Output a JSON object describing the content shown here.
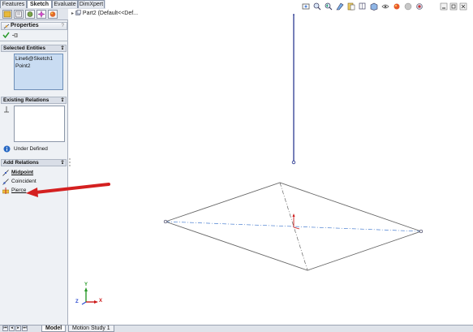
{
  "command_tabs": [
    {
      "label": "Features",
      "active": false
    },
    {
      "label": "Sketch",
      "active": true
    },
    {
      "label": "Evaluate",
      "active": false
    },
    {
      "label": "DimXpert",
      "active": false
    }
  ],
  "panel_icon_tabs": [
    "feature-manager-icon",
    "property-manager-icon",
    "configuration-manager-icon",
    "dimxpert-manager-icon",
    "display-manager-icon"
  ],
  "properties": {
    "title": "Properties",
    "help": "?",
    "ok_icon": "checkmark-icon",
    "pin_icon": "pushpin-icon"
  },
  "selected_entities": {
    "header": "Selected Entities",
    "items": [
      "Line6@Sketch1",
      "Point2"
    ]
  },
  "existing_relations": {
    "header": "Existing Relations",
    "status": "Under Defined",
    "status_icon": "info-icon"
  },
  "add_relations": {
    "header": "Add Relations",
    "items": [
      {
        "label": "Midpoint",
        "icon": "midpoint-icon",
        "bold": true
      },
      {
        "label": "Coincident",
        "icon": "coincident-icon",
        "bold": false
      },
      {
        "label": "Pierce",
        "icon": "pierce-icon",
        "bold": false
      }
    ]
  },
  "graphics": {
    "tree_item": "Part2  (Default<<Def...",
    "triad": {
      "y": "Y",
      "x": "X",
      "z": "Z"
    },
    "colors": {
      "sketch_line": "#555555",
      "selected_line": "#1c2b8a",
      "centerline": "#4a7fd0",
      "arrow": "#cc1a1a",
      "origin": "#cc1a1a"
    }
  },
  "heads_up_toolbar": [
    "zoom-to-fit-icon",
    "zoom-area-icon",
    "previous-view-icon",
    "section-view-icon",
    "dynamic-annotation-icon",
    "view-orientation-icon",
    "display-style-icon",
    "hide-show-icon",
    "edit-appearance-icon",
    "scene-icon",
    "view-settings-icon",
    "minimize-icon",
    "restore-icon",
    "close-icon"
  ],
  "bottom_tabs": [
    {
      "label": "Model",
      "active": true
    },
    {
      "label": "Motion Study 1",
      "active": false
    }
  ],
  "nav_buttons": [
    "first-icon",
    "prev-icon",
    "next-icon",
    "last-icon"
  ]
}
